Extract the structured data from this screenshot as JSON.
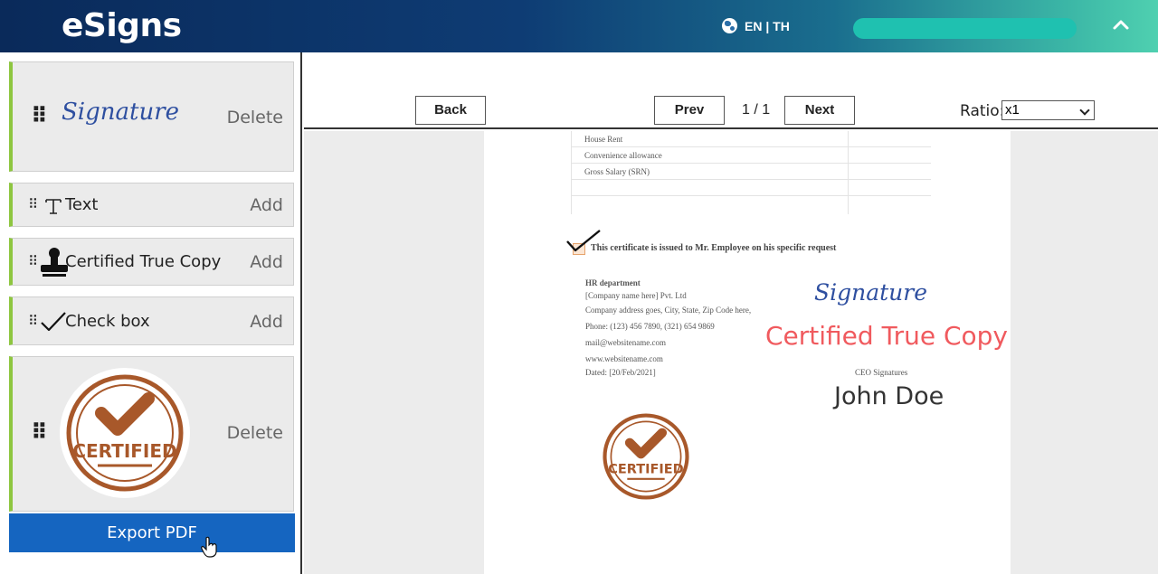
{
  "app": {
    "title": "eSigns"
  },
  "header": {
    "language_label": "EN | TH"
  },
  "sidebar": {
    "items": [
      {
        "type": "signature",
        "preview_text": "Signature",
        "action": "Delete"
      },
      {
        "type": "text",
        "label": "Text",
        "action": "Add",
        "icon": "text-cursor-icon"
      },
      {
        "type": "stamp",
        "label": "Certified True Copy",
        "action": "Add",
        "icon": "stamp-icon"
      },
      {
        "type": "checkbox",
        "label": "Check box",
        "action": "Add",
        "icon": "checkmark-icon"
      },
      {
        "type": "image",
        "stamp_text": "CERTIFIED",
        "action": "Delete"
      }
    ],
    "export_label": "Export PDF"
  },
  "toolbar": {
    "back_label": "Back",
    "prev_label": "Prev",
    "page_indicator": "1 / 1",
    "next_label": "Next",
    "ratio_label": "Ratio:",
    "ratio_value": "x1"
  },
  "document": {
    "salary_rows": [
      "House Rent",
      "Convenience allowance",
      "Gross Salary  (SRN)",
      "",
      ""
    ],
    "certificate_text": "This certificate is issued to Mr. Employee on his specific request",
    "hr": {
      "department": "HR department",
      "company": "[Company name here] Pvt. Ltd",
      "address": "Company address goes, City, State, Zip Code  here,",
      "phone": "Phone: (123) 456 7890,  (321) 654 9869",
      "email": "mail@websitename.com",
      "web": "www.websitename.com",
      "dated": "Dated: [20/Feb/2021]"
    },
    "placed_signature": "Signature",
    "placed_stamp_text": "Certified True Copy",
    "ceo_label": "CEO Signatures",
    "ceo_name": "John Doe",
    "placed_seal_text": "CERTIFIED"
  },
  "colors": {
    "accent_green": "#8ec640",
    "export_blue": "#1565c0",
    "stamp_red": "#f05a5e",
    "seal_brown": "#a8582a",
    "signature_blue": "#2e4fa0"
  }
}
